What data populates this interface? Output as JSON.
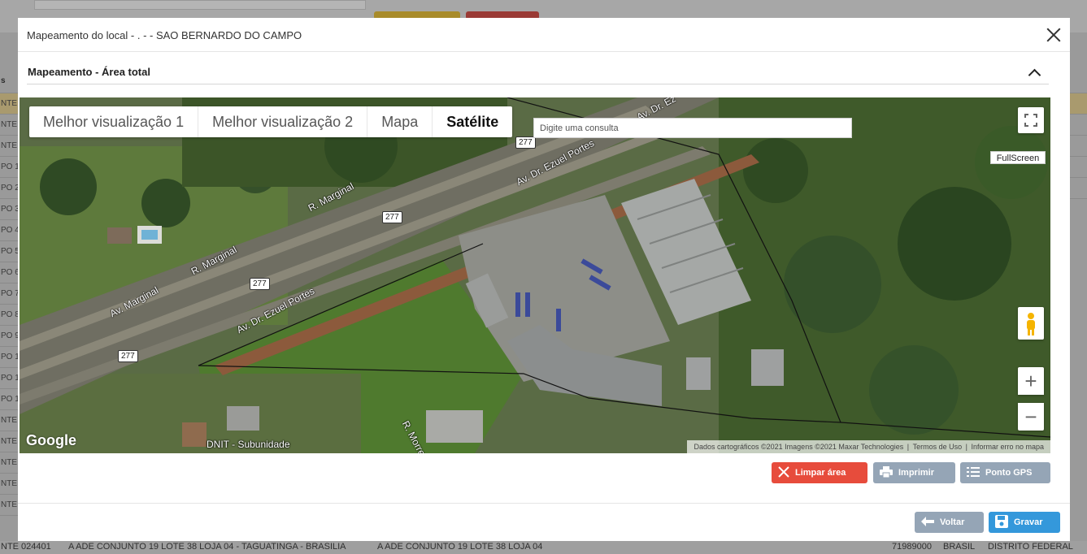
{
  "background": {
    "left_column": [
      "NTE",
      "NTE",
      "NTE",
      "PO 1",
      "PO 2",
      "PO 3",
      "PO 4",
      "PO 5",
      "PO 6",
      "PO 7",
      "PO 8",
      "PO 9",
      "PO 1",
      "PO 1",
      "PO 1",
      "NTE",
      "NTE",
      "NTE",
      "NTE",
      "NTE"
    ],
    "left_header": "s",
    "bottom_row": {
      "col1": "NTE 024401",
      "col2": "A ADE CONJUNTO 19 LOTE 38 LOJA 04 - TAGUATINGA - BRASILIA",
      "col3": "A ADE CONJUNTO 19 LOTE 38 LOJA 04",
      "col4": "71989000",
      "col5": "BRASIL",
      "col6": "DISTRITO FEDERAL"
    }
  },
  "modal": {
    "title": "Mapeamento do local - . - - SAO BERNARDO DO CAMPO",
    "section_title": "Mapeamento - Área total"
  },
  "map": {
    "map_types": [
      "Melhor visualização 1",
      "Melhor visualização 2",
      "Mapa",
      "Satélite"
    ],
    "active_map_type": "Satélite",
    "search_placeholder": "Digite uma consulta",
    "fullscreen_label": "FullScreen",
    "google_logo": "Google",
    "attribution": [
      "Dados cartográficos ©2021 Imagens ©2021 Maxar Technologies",
      "Termos de Uso",
      "Informar erro no mapa"
    ],
    "labels": {
      "av_dr_ezuel_portes_1": "Av. Dr. Ezuel Portes",
      "av_dr_ezuel_portes_2": "Av. Dr. Ezuel Portes",
      "av_dr_ezuel_portes_3": "Av. Dr. Ez",
      "r_marginal_1": "R. Marginal",
      "r_marginal_2": "R. Marginal",
      "av_marginal": "Av. Marginal",
      "r_morretes": "R. Morretes",
      "dnit": "DNIT - Subunidade",
      "shield_277": "277"
    }
  },
  "actions": {
    "clear_area": "Limpar área",
    "print": "Imprimir",
    "gps_point": "Ponto GPS",
    "back": "Voltar",
    "save": "Gravar"
  }
}
